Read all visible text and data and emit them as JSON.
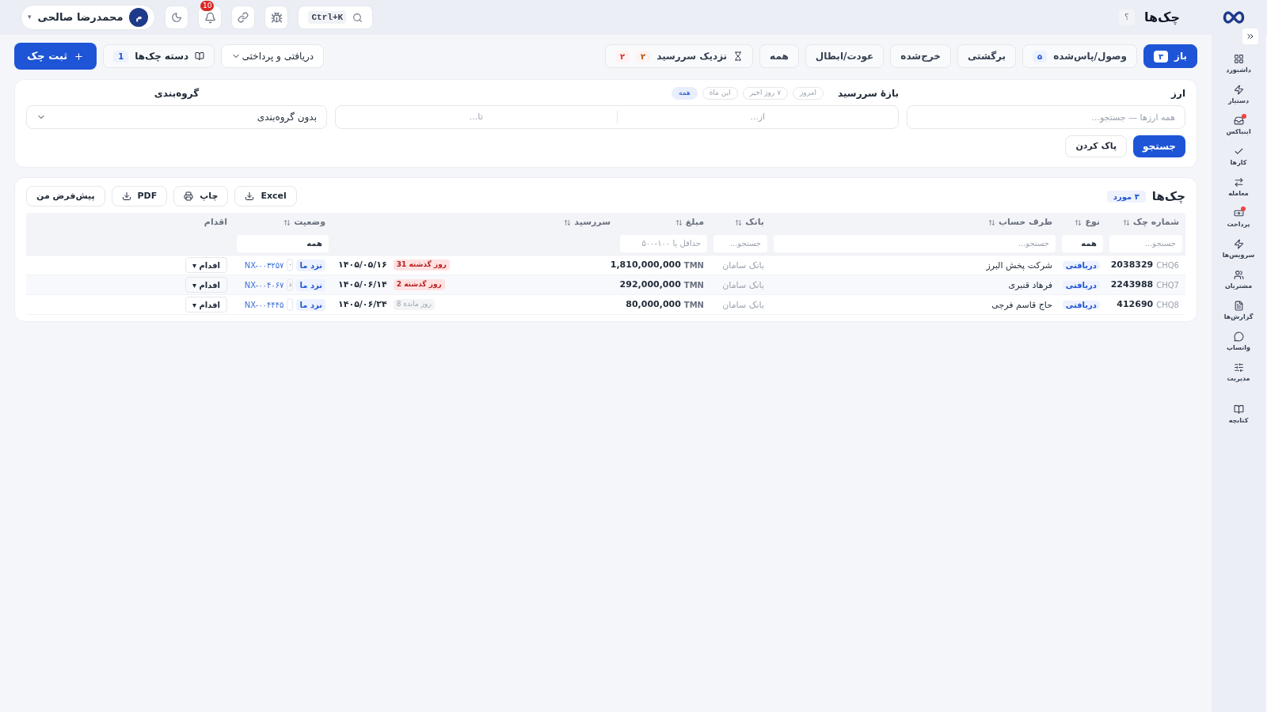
{
  "header": {
    "title": "چک‌ها",
    "help": "؟",
    "search_shortcut": "Ctrl+K",
    "notifications": "10",
    "user": {
      "name": "محمدرضا صالحی",
      "initial": "م",
      "caret": "▾"
    }
  },
  "sidebar": {
    "items": [
      {
        "label": "داشبورد",
        "badge": false
      },
      {
        "label": "دستیار",
        "badge": false
      },
      {
        "label": "اینباکس",
        "badge": true
      },
      {
        "label": "کارها",
        "badge": false
      },
      {
        "label": "معامله",
        "badge": false
      },
      {
        "label": "پرداخت",
        "badge": true
      },
      {
        "label": "سرویس‌ها",
        "badge": false
      },
      {
        "label": "مشتریان",
        "badge": false
      },
      {
        "label": "گزارش‌ها",
        "badge": false
      },
      {
        "label": "واتساپ",
        "badge": false
      },
      {
        "label": "مدیریت",
        "badge": false
      },
      {
        "label": "کتابچه",
        "badge": false
      }
    ]
  },
  "status_tabs": [
    {
      "label": "باز",
      "count": "۳",
      "selected": true
    },
    {
      "label": "وصول/پاس‌شده",
      "count": "۵",
      "selected": false
    },
    {
      "label": "برگشتی",
      "selected": false
    },
    {
      "label": "خرج‌شده",
      "selected": false
    },
    {
      "label": "عودت/ابطال",
      "selected": false
    },
    {
      "label": "همه",
      "selected": false
    },
    {
      "label": "نزدیک سررسید",
      "kind": "due",
      "counts": [
        {
          "text": "۲",
          "color": "#b45309"
        },
        {
          "text": "۲",
          "color": "#dc2626"
        }
      ],
      "selected": false
    }
  ],
  "actions": {
    "new_check": "ثبت چک",
    "checkbooks": {
      "label": "دسته چک‌ها",
      "count": "1"
    },
    "direction": "دریافتی و پرداختی"
  },
  "filters": {
    "currency": {
      "label": "ارز",
      "placeholder": "همه ارزها — جستجو..."
    },
    "due_range": {
      "label": "بازهٔ سررسید",
      "chips": [
        {
          "label": "امروز",
          "selected": false
        },
        {
          "label": "۷ روز اخیر",
          "selected": false
        },
        {
          "label": "این ماه",
          "selected": false
        },
        {
          "label": "همه",
          "selected": true
        }
      ],
      "from_placeholder": "از...",
      "to_placeholder": "تا..."
    },
    "grouping": {
      "label": "گروه‌بندی",
      "value": "بدون گروه‌بندی"
    },
    "search_button": "جستجو",
    "clear_button": "پاک کردن"
  },
  "table": {
    "title": "چک‌ها",
    "count": "۳ مورد",
    "exports": [
      "Excel",
      "چاپ",
      "PDF"
    ],
    "default_view": "پیش‌فرض من",
    "columns": [
      {
        "label": "شماره چک",
        "sortable": true
      },
      {
        "label": "نوع",
        "sortable": true
      },
      {
        "label": "طرف حساب",
        "sortable": true
      },
      {
        "label": "بانک",
        "sortable": true
      },
      {
        "label": "مبلغ",
        "sortable": true
      },
      {
        "label": "سررسید",
        "sortable": true
      },
      {
        "label": "وضعیت",
        "sortable": true
      },
      {
        "label": "اقدام",
        "sortable": false
      }
    ],
    "column_filters": {
      "number": {
        "placeholder": "جستجو..."
      },
      "type": "همه",
      "party": {
        "placeholder": "جستجو..."
      },
      "bank": {
        "placeholder": "جستجو..."
      },
      "amount": {
        "placeholder": "حداقل یا ۱۰۰-۵۰۰"
      },
      "status": "همه"
    },
    "rows": [
      {
        "prefix": "CHQ6",
        "number": "2038329",
        "type": "دریافتی",
        "party": "شرکت پخش البرز",
        "bank": "بانک سامان",
        "amount": "1,810,000,000",
        "currency": "TMN",
        "due_badge": {
          "text": "روز گذشته 31",
          "overdue": true
        },
        "date": "۱۴۰۵/۰۵/۱۶",
        "status": "نزد ما",
        "cut": "۰",
        "ref": "NX-۰۰۳۲۵۷",
        "action": "اقدام ▾"
      },
      {
        "prefix": "CHQ7",
        "number": "2243988",
        "type": "دریافتی",
        "party": "فرهاد قنبری",
        "bank": "بانک سامان",
        "amount": "292,000,000",
        "currency": "TMN",
        "due_badge": {
          "text": "روز گذشته 2",
          "overdue": true
        },
        "date": "۱۴۰۵/۰۶/۱۴",
        "status": "نزد ما",
        "cut": "ذ",
        "ref": "NX-۰۰۴۰۶۷",
        "action": "اقدام ▾"
      },
      {
        "prefix": "CHQ8",
        "number": "412690",
        "type": "دریافتی",
        "party": "حاج قاسم فرجی",
        "bank": "بانک سامان",
        "amount": "80,000,000",
        "currency": "TMN",
        "due_badge": {
          "text": "روز مانده 8",
          "overdue": false
        },
        "date": "۱۴۰۵/۰۶/۲۴",
        "status": "نزد ما",
        "ref": "NX-۰۰۴۴۴۵",
        "action": "اقدام ▾"
      }
    ]
  }
}
